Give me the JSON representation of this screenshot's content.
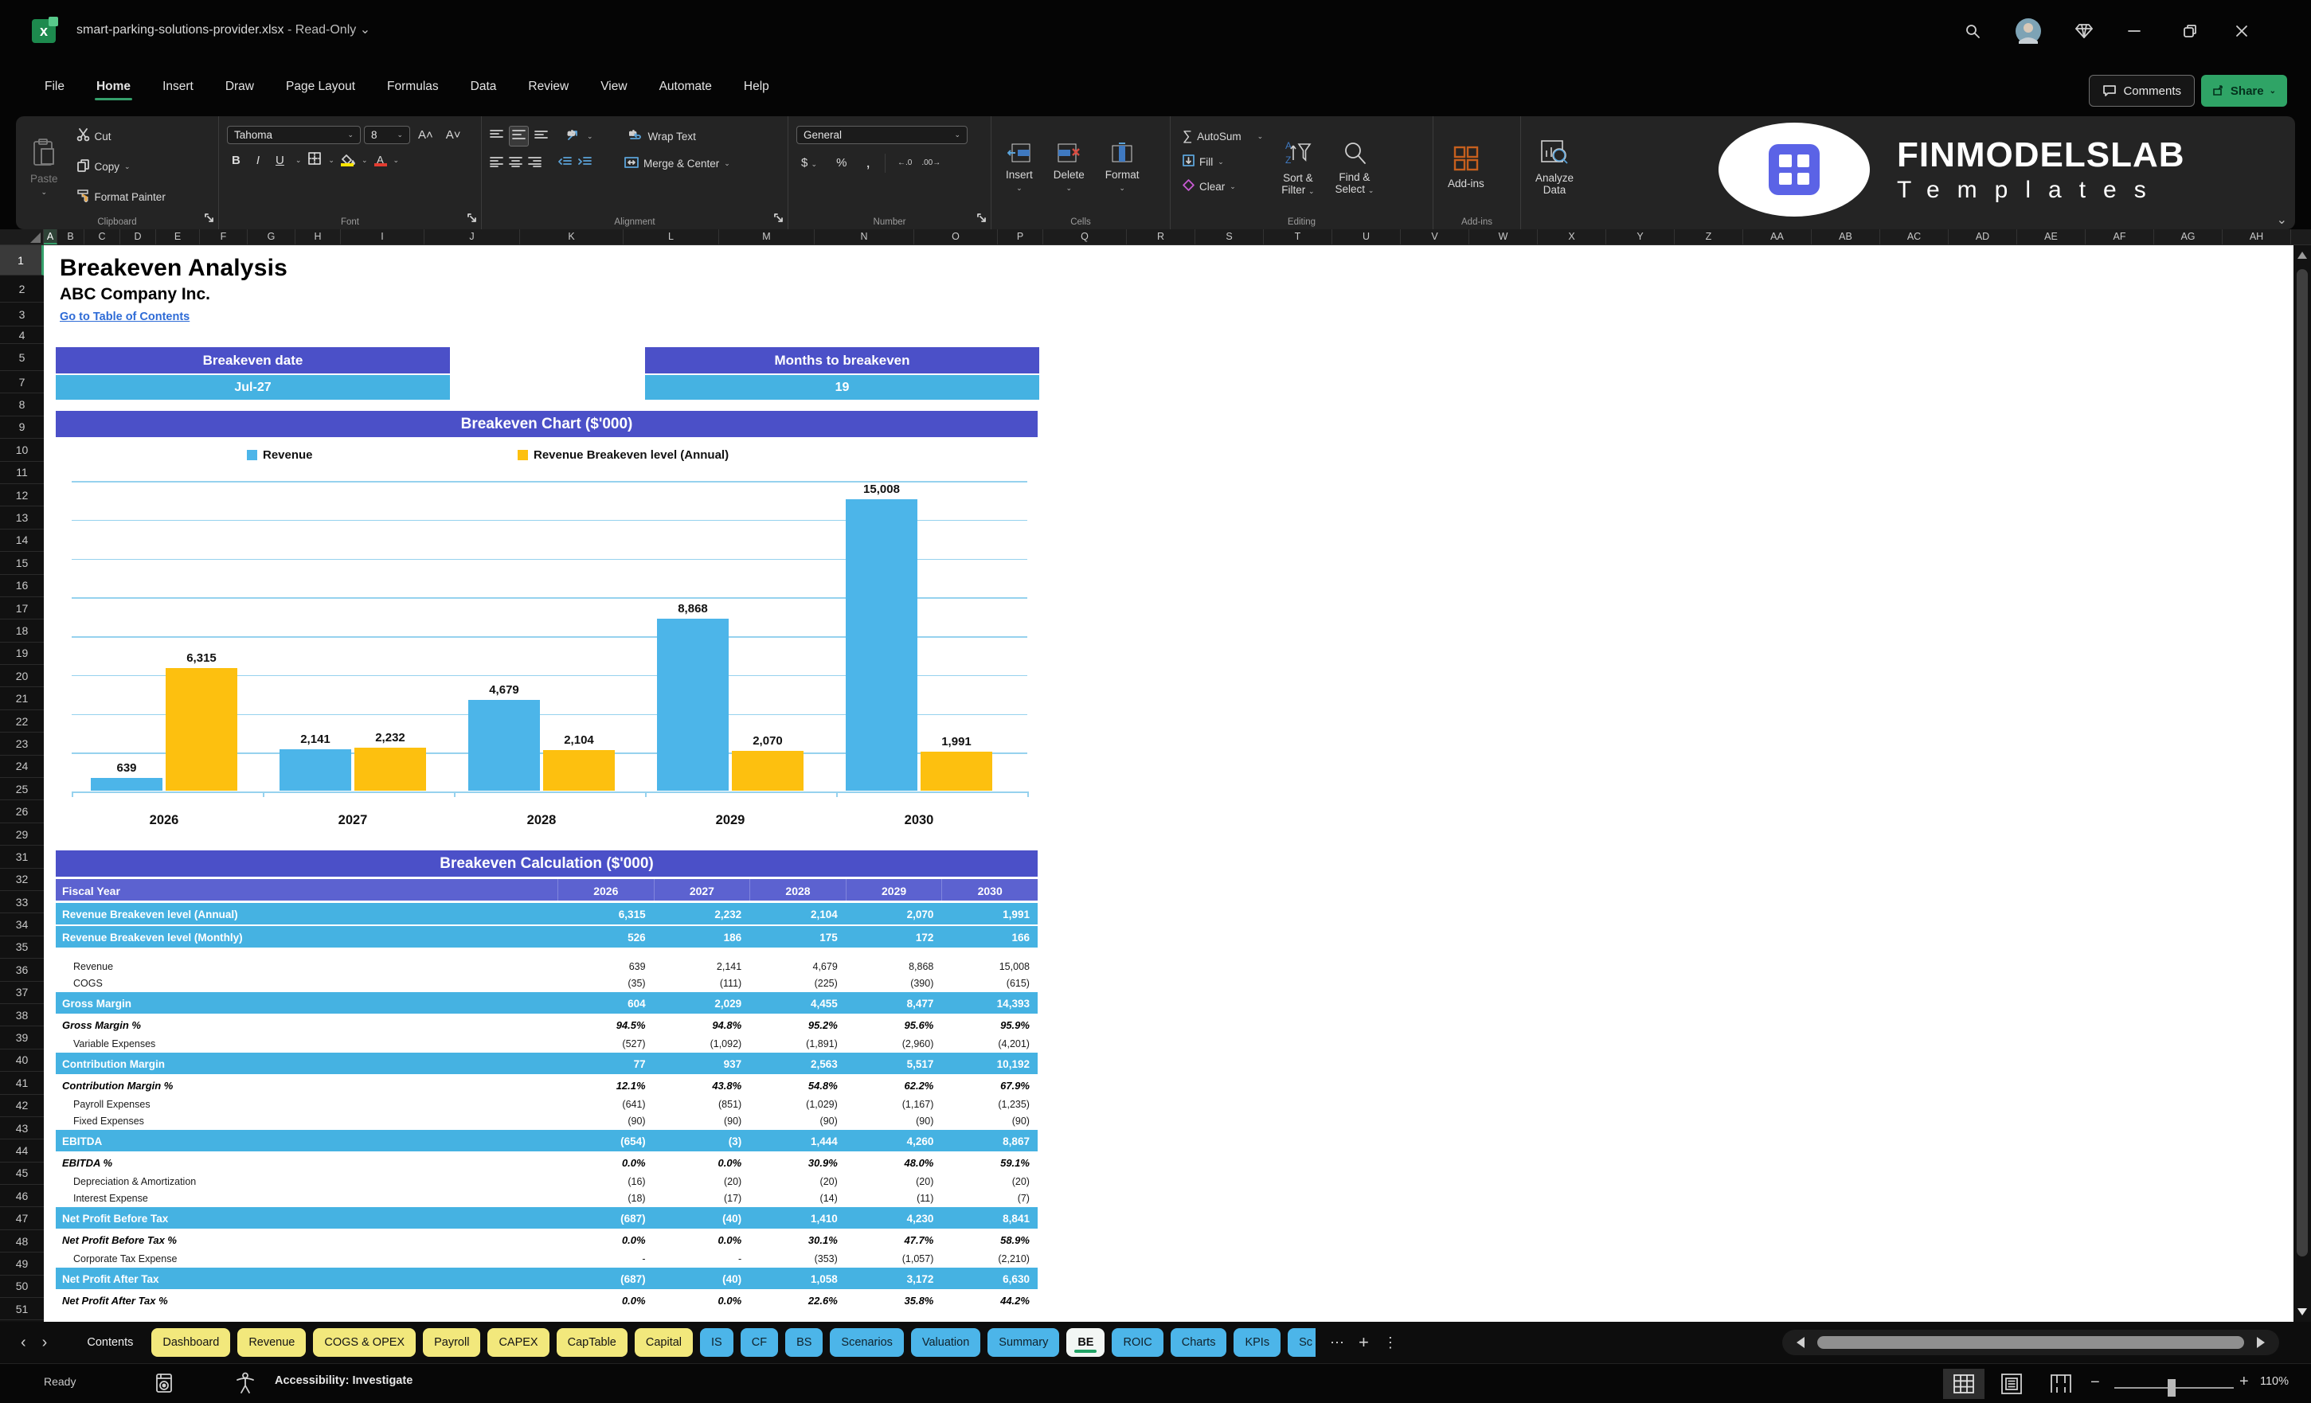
{
  "colors": {
    "accent_purple": "#4B50C8",
    "header_purple_light": "#5C62D0",
    "band_blue": "#45B2E2",
    "bar_blue": "#4CB5E9",
    "bar_yellow": "#FDC00F",
    "tab_yellow": "#F2E87C",
    "excel_green": "#21A366",
    "link_blue": "#2E6BD6"
  },
  "titlebar": {
    "doc_name": "smart-parking-solutions-provider.xlsx",
    "separator": "-",
    "mode": "Read-Only"
  },
  "menu": {
    "items": [
      "File",
      "Home",
      "Insert",
      "Draw",
      "Page Layout",
      "Formulas",
      "Data",
      "Review",
      "View",
      "Automate",
      "Help"
    ],
    "active": "Home",
    "comments_label": "Comments",
    "share_label": "Share"
  },
  "ribbon": {
    "clipboard": {
      "title": "Clipboard",
      "paste": "Paste",
      "cut": "Cut",
      "copy": "Copy",
      "format_painter": "Format Painter"
    },
    "font": {
      "title": "Font",
      "font_name": "Tahoma",
      "font_size": "8",
      "bold": "B",
      "italic": "I",
      "underline": "U"
    },
    "alignment": {
      "title": "Alignment",
      "wrap_text": "Wrap Text",
      "merge_center": "Merge & Center"
    },
    "number": {
      "title": "Number",
      "format": "General",
      "currency": "$",
      "percent": "%",
      "comma": ",",
      "inc_dec": "←.0",
      "dec_dec": ".00→"
    },
    "cells": {
      "title": "Cells",
      "insert": "Insert",
      "delete": "Delete",
      "format": "Format"
    },
    "editing": {
      "title": "Editing",
      "autosum": "AutoSum",
      "fill": "Fill",
      "clear": "Clear",
      "sort_filter_1": "Sort &",
      "sort_filter_2": "Filter",
      "find_select_1": "Find &",
      "find_select_2": "Select"
    },
    "addins": {
      "title": "Add-ins",
      "label": "Add-ins"
    },
    "analyze": {
      "line1": "Analyze",
      "line2": "Data"
    },
    "logo": {
      "line1": "FINMODELSLAB",
      "line2": "Templates"
    }
  },
  "grid": {
    "columns": [
      "A",
      "B",
      "C",
      "D",
      "E",
      "F",
      "G",
      "H",
      "I",
      "J",
      "K",
      "L",
      "M",
      "N",
      "O",
      "P",
      "Q",
      "R",
      "S",
      "T",
      "U",
      "V",
      "W",
      "X",
      "Y",
      "Z",
      "AA",
      "AB",
      "AC",
      "AD",
      "AE",
      "AF",
      "AG",
      "AH"
    ],
    "row_numbers": [
      1,
      2,
      3,
      4,
      5,
      7,
      8,
      9,
      10,
      11,
      12,
      13,
      14,
      15,
      16,
      17,
      18,
      19,
      20,
      21,
      22,
      23,
      24,
      25,
      26,
      29,
      31,
      32,
      33,
      34,
      35,
      36,
      37,
      38,
      39,
      40,
      41,
      42,
      43,
      44,
      45,
      46,
      47,
      48,
      49,
      50,
      51
    ],
    "selected_column": "A",
    "selected_row": 1
  },
  "sheet": {
    "title": "Breakeven Analysis",
    "company": "ABC Company Inc.",
    "link": "Go to Table of Contents",
    "kpis": [
      {
        "label": "Breakeven date",
        "value": "Jul-27"
      },
      {
        "label": "Months to breakeven",
        "value": "19"
      }
    ],
    "chart_title": "Breakeven Chart ($'000)",
    "calc_title": "Breakeven Calculation ($'000)",
    "table": {
      "header_label": "Fiscal Year",
      "years": [
        "2026",
        "2027",
        "2028",
        "2029",
        "2030"
      ],
      "rows": [
        {
          "label": "Revenue Breakeven level (Annual)",
          "style": "band",
          "values": [
            "6,315",
            "2,232",
            "2,104",
            "2,070",
            "1,991"
          ]
        },
        {
          "label": "Revenue Breakeven level (Monthly)",
          "style": "band",
          "values": [
            "526",
            "186",
            "175",
            "172",
            "166"
          ]
        },
        {
          "label": "Revenue",
          "style": "sub",
          "gap": true,
          "values": [
            "639",
            "2,141",
            "4,679",
            "8,868",
            "15,008"
          ]
        },
        {
          "label": "COGS",
          "style": "sub",
          "values": [
            "(35)",
            "(111)",
            "(225)",
            "(390)",
            "(615)"
          ]
        },
        {
          "label": "Gross Margin",
          "style": "band",
          "values": [
            "604",
            "2,029",
            "4,455",
            "8,477",
            "14,393"
          ]
        },
        {
          "label": "Gross Margin %",
          "style": "pct",
          "values": [
            "94.5%",
            "94.8%",
            "95.2%",
            "95.6%",
            "95.9%"
          ]
        },
        {
          "label": "Variable Expenses",
          "style": "sub",
          "values": [
            "(527)",
            "(1,092)",
            "(1,891)",
            "(2,960)",
            "(4,201)"
          ]
        },
        {
          "label": "Contribution Margin",
          "style": "band",
          "values": [
            "77",
            "937",
            "2,563",
            "5,517",
            "10,192"
          ]
        },
        {
          "label": "Contribution Margin %",
          "style": "pct",
          "values": [
            "12.1%",
            "43.8%",
            "54.8%",
            "62.2%",
            "67.9%"
          ]
        },
        {
          "label": "Payroll Expenses",
          "style": "sub",
          "values": [
            "(641)",
            "(851)",
            "(1,029)",
            "(1,167)",
            "(1,235)"
          ]
        },
        {
          "label": "Fixed Expenses",
          "style": "sub",
          "values": [
            "(90)",
            "(90)",
            "(90)",
            "(90)",
            "(90)"
          ]
        },
        {
          "label": "EBITDA",
          "style": "band",
          "values": [
            "(654)",
            "(3)",
            "1,444",
            "4,260",
            "8,867"
          ]
        },
        {
          "label": "EBITDA %",
          "style": "pct",
          "values": [
            "0.0%",
            "0.0%",
            "30.9%",
            "48.0%",
            "59.1%"
          ]
        },
        {
          "label": "Depreciation & Amortization",
          "style": "sub",
          "values": [
            "(16)",
            "(20)",
            "(20)",
            "(20)",
            "(20)"
          ]
        },
        {
          "label": "Interest Expense",
          "style": "sub",
          "values": [
            "(18)",
            "(17)",
            "(14)",
            "(11)",
            "(7)"
          ]
        },
        {
          "label": "Net Profit Before Tax",
          "style": "band",
          "values": [
            "(687)",
            "(40)",
            "1,410",
            "4,230",
            "8,841"
          ]
        },
        {
          "label": "Net Profit Before Tax %",
          "style": "pct",
          "values": [
            "0.0%",
            "0.0%",
            "30.1%",
            "47.7%",
            "58.9%"
          ]
        },
        {
          "label": "Corporate Tax Expense",
          "style": "sub",
          "values": [
            "-",
            "-",
            "(353)",
            "(1,057)",
            "(2,210)"
          ]
        },
        {
          "label": "Net Profit After Tax",
          "style": "band",
          "values": [
            "(687)",
            "(40)",
            "1,058",
            "3,172",
            "6,630"
          ]
        },
        {
          "label": "Net Profit After Tax %",
          "style": "pct",
          "values": [
            "0.0%",
            "0.0%",
            "22.6%",
            "35.8%",
            "44.2%"
          ]
        }
      ]
    }
  },
  "chart_data": {
    "type": "bar",
    "title": "Breakeven Chart ($'000)",
    "categories": [
      "2026",
      "2027",
      "2028",
      "2029",
      "2030"
    ],
    "series": [
      {
        "name": "Revenue",
        "color": "#4CB5E9",
        "values": [
          639,
          2141,
          4679,
          8868,
          15008
        ]
      },
      {
        "name": "Revenue Breakeven level (Annual)",
        "color": "#FDC00F",
        "values": [
          6315,
          2232,
          2104,
          2070,
          1991
        ]
      }
    ],
    "value_labels": [
      [
        "639",
        "2,141",
        "4,679",
        "8,868",
        "15,008"
      ],
      [
        "6,315",
        "2,232",
        "2,104",
        "2,070",
        "1,991"
      ]
    ],
    "ylim": [
      0,
      16000
    ],
    "gridline_step": 2000,
    "grid": true,
    "legend_position": "top"
  },
  "tabs": {
    "items": [
      {
        "label": "Contents",
        "type": "plain"
      },
      {
        "label": "Dashboard",
        "type": "yellow"
      },
      {
        "label": "Revenue",
        "type": "yellow"
      },
      {
        "label": "COGS & OPEX",
        "type": "yellow"
      },
      {
        "label": "Payroll",
        "type": "yellow"
      },
      {
        "label": "CAPEX",
        "type": "yellow"
      },
      {
        "label": "CapTable",
        "type": "yellow"
      },
      {
        "label": "Capital",
        "type": "yellow"
      },
      {
        "label": "IS",
        "type": "blue"
      },
      {
        "label": "CF",
        "type": "blue"
      },
      {
        "label": "BS",
        "type": "blue"
      },
      {
        "label": "Scenarios",
        "type": "blue"
      },
      {
        "label": "Valuation",
        "type": "blue"
      },
      {
        "label": "Summary",
        "type": "blue"
      },
      {
        "label": "BE",
        "type": "active"
      },
      {
        "label": "ROIC",
        "type": "blue"
      },
      {
        "label": "Charts",
        "type": "blue"
      },
      {
        "label": "KPIs",
        "type": "blue"
      },
      {
        "label": "Sc",
        "type": "blue cut"
      }
    ],
    "more": "⋯",
    "add": "+",
    "menu": "⋮"
  },
  "status": {
    "ready": "Ready",
    "accessibility": "Accessibility: Investigate",
    "zoom_pct": "110%",
    "zoom_minus": "−",
    "zoom_plus": "+"
  }
}
